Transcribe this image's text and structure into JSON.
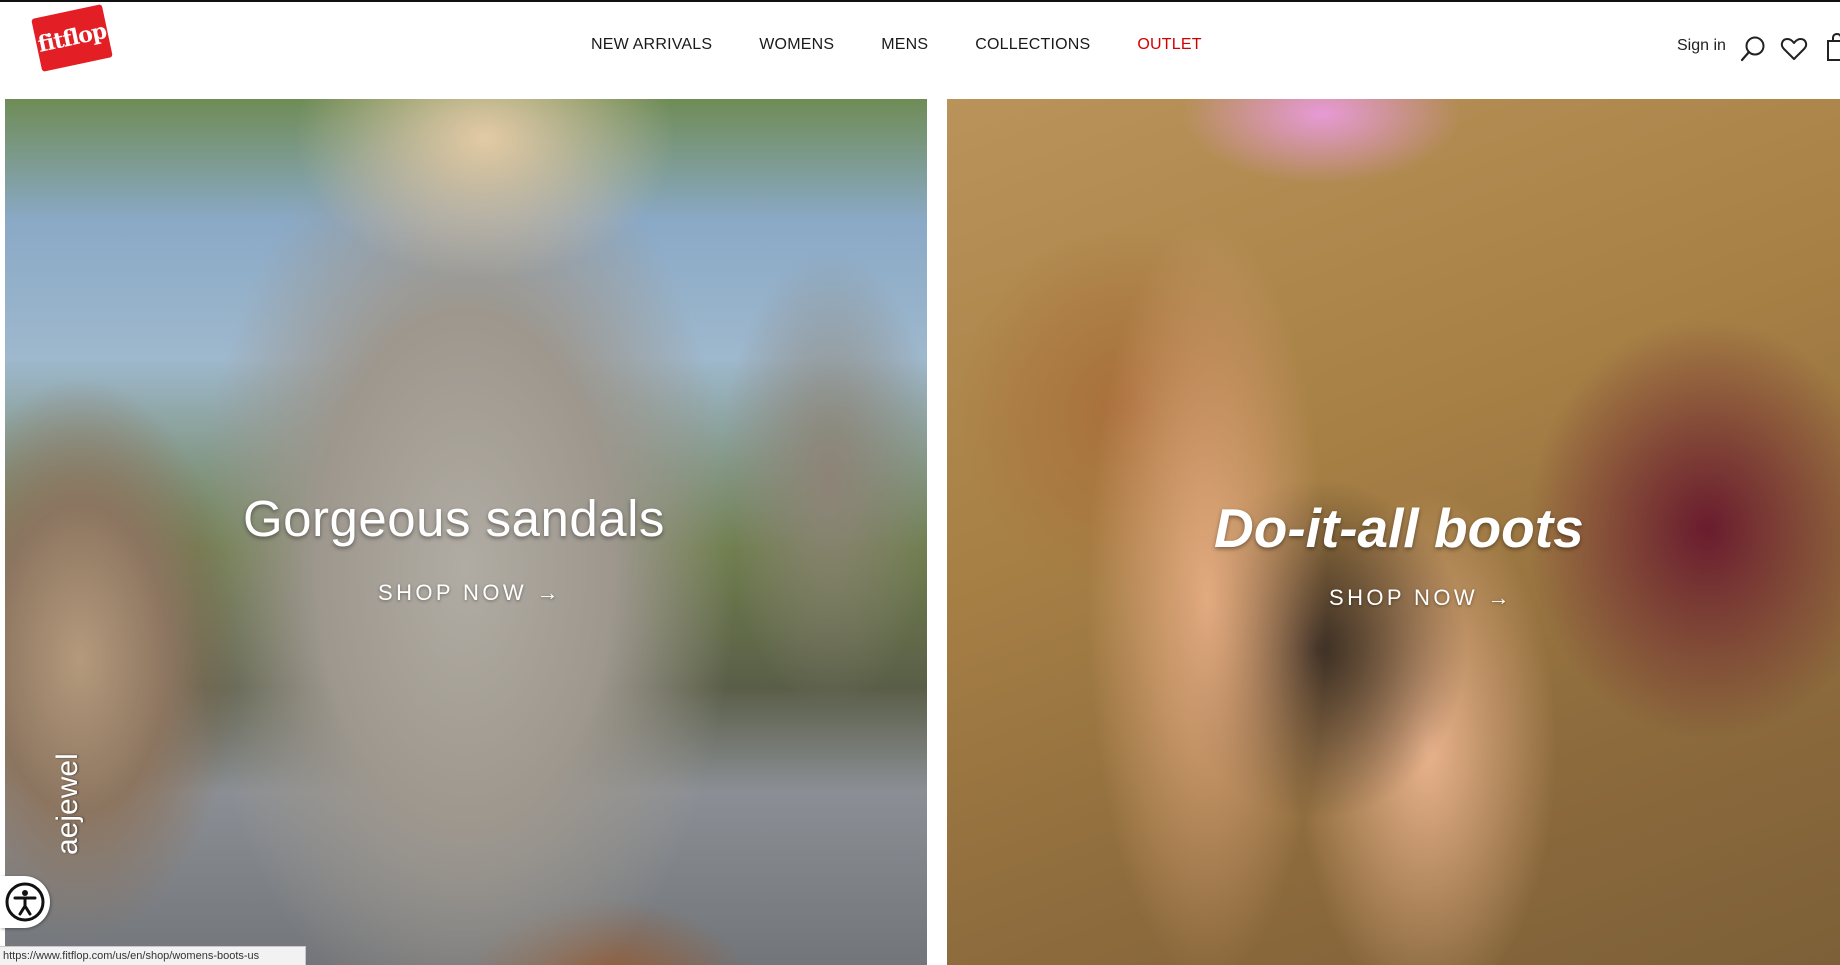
{
  "header": {
    "logo_text": "fitflop",
    "nav": [
      "NEW ARRIVALS",
      "WOMENS",
      "MENS",
      "COLLECTIONS",
      "OUTLET"
    ],
    "sign_in": "Sign in",
    "icons": [
      "search-icon",
      "heart-icon",
      "bag-icon"
    ]
  },
  "promos": [
    {
      "headline": "Gorgeous sandals",
      "cta": "SHOP NOW →",
      "watermark": "aejewel"
    },
    {
      "headline": "Do-it-all boots",
      "cta": "SHOP NOW →"
    }
  ],
  "accessibility_icon": "accessibility-icon",
  "status_bar": {
    "url": "https://www.fitflop.com/us/en/shop/womens-boots-us"
  },
  "colors": {
    "brand_red": "#e31e24",
    "outlet_red": "#d40000"
  }
}
